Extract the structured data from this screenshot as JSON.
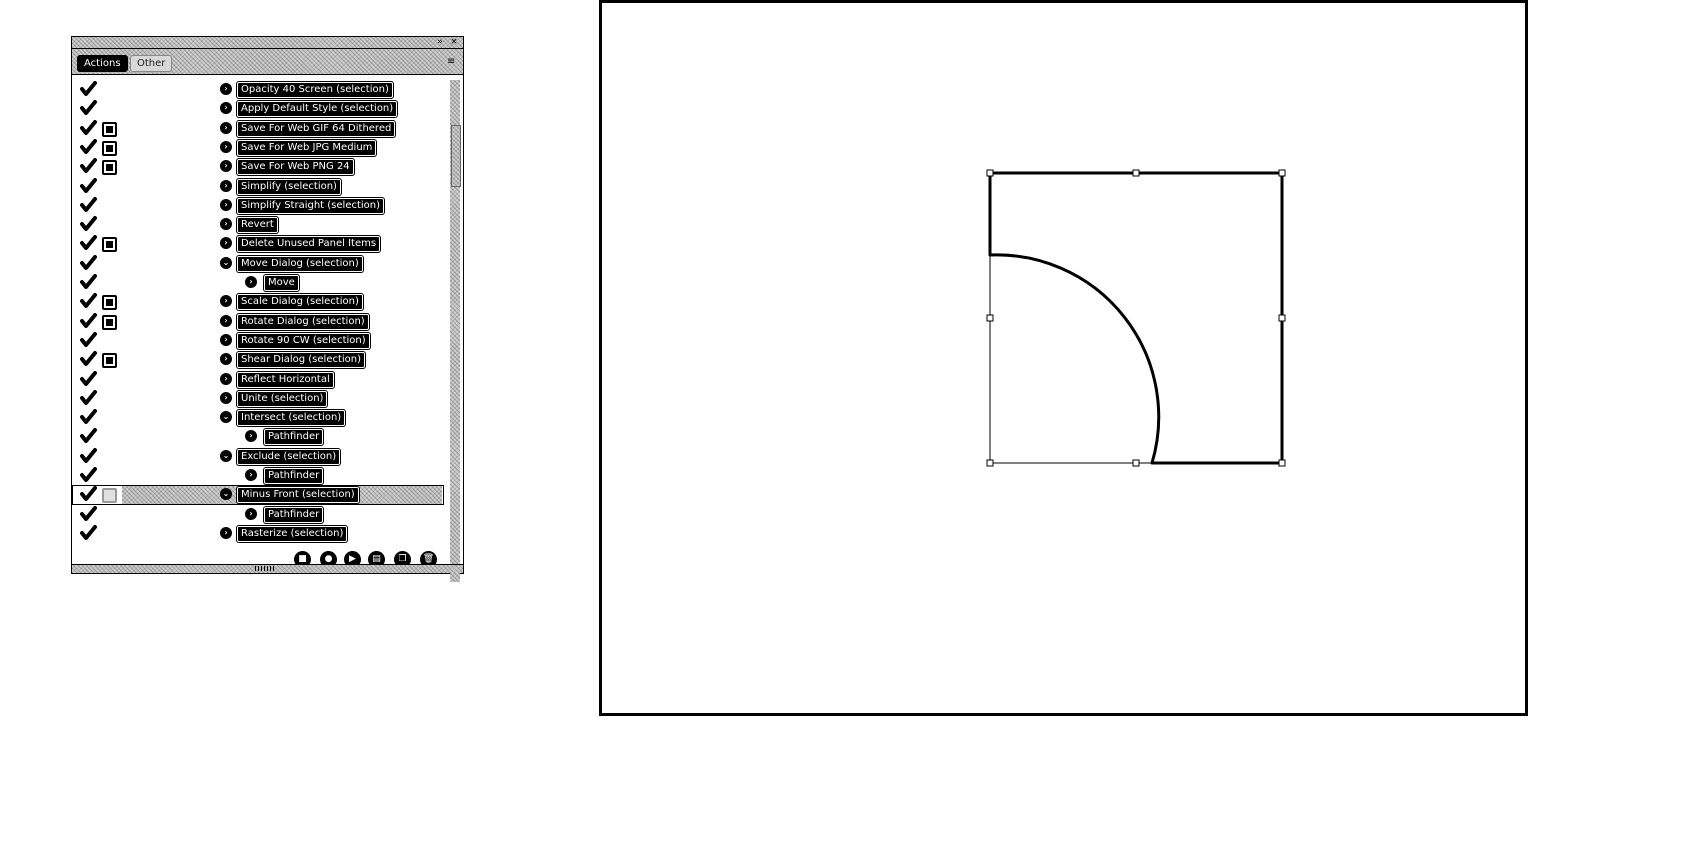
{
  "panel": {
    "tabs": [
      {
        "label": "Actions"
      },
      {
        "label": "Other"
      }
    ],
    "titlebar": {
      "collapse_icon": "double-arrow-icon",
      "close_icon": "close-icon"
    },
    "menu_icon": "panel-menu-icon",
    "items": [
      {
        "label": "Opacity 40 Screen (selection)",
        "checked": true,
        "dialog": false,
        "expanded": false,
        "indent": 0
      },
      {
        "label": "Apply Default Style (selection)",
        "checked": true,
        "dialog": false,
        "expanded": false,
        "indent": 0
      },
      {
        "label": "Save For Web GIF 64 Dithered",
        "checked": true,
        "dialog": true,
        "expanded": false,
        "indent": 0
      },
      {
        "label": "Save For Web JPG Medium",
        "checked": true,
        "dialog": true,
        "expanded": false,
        "indent": 0
      },
      {
        "label": "Save For Web PNG 24",
        "checked": true,
        "dialog": true,
        "expanded": false,
        "indent": 0
      },
      {
        "label": "Simplify (selection)",
        "checked": true,
        "dialog": false,
        "expanded": false,
        "indent": 0
      },
      {
        "label": "Simplify Straight (selection)",
        "checked": true,
        "dialog": false,
        "expanded": false,
        "indent": 0
      },
      {
        "label": "Revert",
        "checked": true,
        "dialog": false,
        "expanded": false,
        "indent": 0
      },
      {
        "label": "Delete Unused Panel Items",
        "checked": true,
        "dialog": true,
        "expanded": false,
        "indent": 0
      },
      {
        "label": "Move Dialog (selection)",
        "checked": true,
        "dialog": false,
        "expanded": true,
        "indent": 0
      },
      {
        "label": "Move",
        "checked": true,
        "dialog": false,
        "expanded": false,
        "indent": 1
      },
      {
        "label": "Scale Dialog (selection)",
        "checked": true,
        "dialog": true,
        "expanded": false,
        "indent": 0
      },
      {
        "label": "Rotate Dialog (selection)",
        "checked": true,
        "dialog": true,
        "expanded": false,
        "indent": 0
      },
      {
        "label": "Rotate 90 CW (selection)",
        "checked": true,
        "dialog": false,
        "expanded": false,
        "indent": 0
      },
      {
        "label": "Shear Dialog (selection)",
        "checked": true,
        "dialog": true,
        "expanded": false,
        "indent": 0
      },
      {
        "label": "Reflect Horizontal",
        "checked": true,
        "dialog": false,
        "expanded": false,
        "indent": 0
      },
      {
        "label": "Unite (selection)",
        "checked": true,
        "dialog": false,
        "expanded": false,
        "indent": 0
      },
      {
        "label": "Intersect (selection)",
        "checked": true,
        "dialog": false,
        "expanded": true,
        "indent": 0
      },
      {
        "label": "Pathfinder",
        "checked": true,
        "dialog": false,
        "expanded": false,
        "indent": 1
      },
      {
        "label": "Exclude (selection)",
        "checked": true,
        "dialog": false,
        "expanded": true,
        "indent": 0
      },
      {
        "label": "Pathfinder",
        "checked": true,
        "dialog": false,
        "expanded": false,
        "indent": 1
      },
      {
        "label": "Minus Front (selection)",
        "checked": true,
        "dialog": "empty",
        "expanded": true,
        "indent": 0,
        "selected": true
      },
      {
        "label": "Pathfinder",
        "checked": true,
        "dialog": false,
        "expanded": false,
        "indent": 1
      },
      {
        "label": "Rasterize (selection)",
        "checked": true,
        "dialog": false,
        "expanded": false,
        "indent": 0
      }
    ],
    "bottom_buttons": [
      {
        "name": "stop-button",
        "icon": "stop-icon",
        "glyph": "■"
      },
      {
        "name": "record-button",
        "icon": "record-icon",
        "glyph": "●"
      },
      {
        "name": "play-button",
        "icon": "play-icon",
        "glyph": "▶"
      },
      {
        "name": "new-set-button",
        "icon": "folder-icon",
        "glyph": "▤"
      },
      {
        "name": "new-action-button",
        "icon": "new-page-icon",
        "glyph": "❐"
      },
      {
        "name": "delete-button",
        "icon": "trash-icon",
        "glyph": "🗑"
      }
    ]
  },
  "artboard": {
    "shape": "square-minus-quarter-circle",
    "selected": true
  },
  "colors": {
    "ink": "#000000",
    "paper": "#ffffff",
    "dither": "#cfcfcf"
  }
}
